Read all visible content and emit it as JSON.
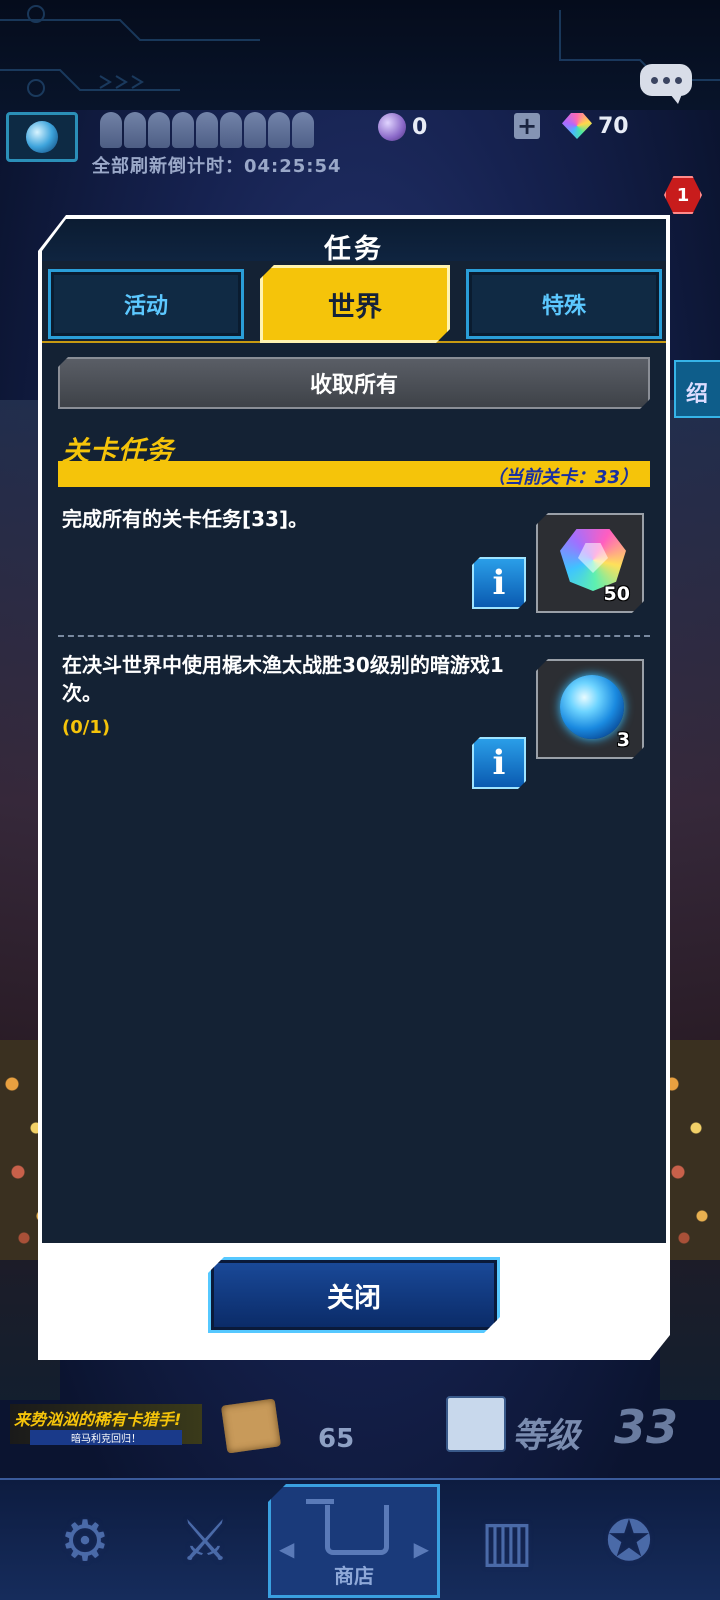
{
  "hud": {
    "refresh_countdown": "全部刷新倒计时：04:25:54",
    "currency_a": "0",
    "currency_gems": "70",
    "plus": "+",
    "notification_count": "1",
    "side_label": "绍"
  },
  "modal": {
    "title": "任务",
    "tabs": [
      {
        "label": "活动",
        "active": false
      },
      {
        "label": "世界",
        "active": true
      },
      {
        "label": "特殊",
        "active": false
      }
    ],
    "collect_all_label": "收取所有",
    "section_title": "关卡任务",
    "current_stage": "（当前关卡：33）",
    "missions": [
      {
        "text": "完成所有的关卡任务[33]。",
        "progress": "",
        "reward_icon": "rainbow-gem-icon",
        "reward_count": "50"
      },
      {
        "text": "在决斗世界中使用梶木渔太战胜30级别的暗游戏1次。",
        "progress": "(0/1)",
        "reward_icon": "blue-orb-icon",
        "reward_count": "3"
      }
    ],
    "info_glyph": "i",
    "close_label": "关闭"
  },
  "bottom": {
    "promo_main": "来势汹汹的稀有卡猎手!",
    "promo_sub": "暗马利克回归！",
    "card_count": "65",
    "level_label": "等级",
    "level_value": "33",
    "shop_label": "商店"
  },
  "colors": {
    "accent_yellow": "#f5c40a",
    "tab_blue": "#2a9ed8",
    "panel_dark": "#142234"
  }
}
